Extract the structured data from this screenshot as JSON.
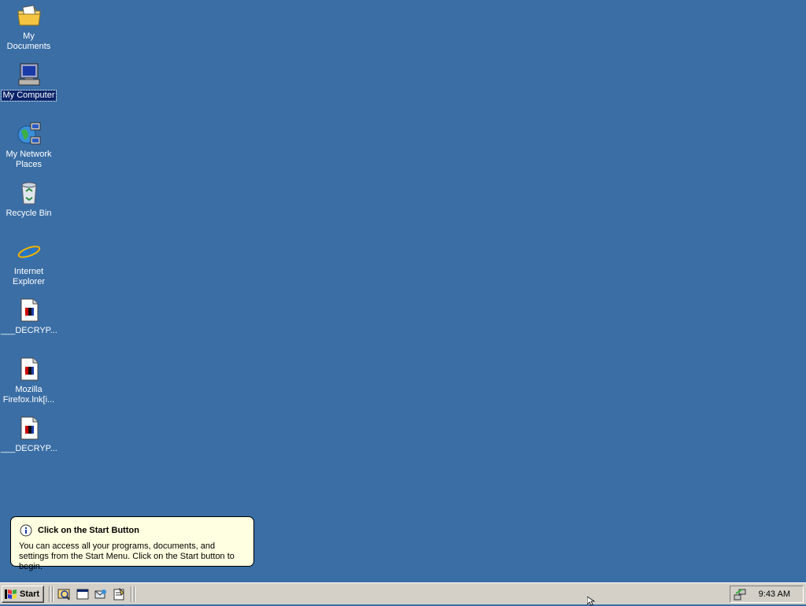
{
  "desktop": {
    "icons": [
      {
        "label": "My Documents",
        "icon": "folder-documents-icon"
      },
      {
        "label": "My Computer",
        "icon": "computer-icon",
        "selected": true
      },
      {
        "label": "My Network Places",
        "icon": "network-icon"
      },
      {
        "label": "Recycle Bin",
        "icon": "recycle-bin-icon"
      },
      {
        "label": "Internet Explorer",
        "icon": "ie-icon"
      },
      {
        "label": "___DECRYP...",
        "icon": "file-shortcut-icon"
      },
      {
        "label": "Mozilla Firefox.lnk[i...",
        "icon": "file-shortcut-icon"
      },
      {
        "label": "___DECRYP...",
        "icon": "file-shortcut-icon"
      }
    ],
    "background_color": "#3a6ea5"
  },
  "balloon": {
    "title": "Click on the Start Button",
    "body": "You can access all your programs, documents, and settings from the Start Menu. Click on the Start button to begin.",
    "icon": "info-icon"
  },
  "taskbar": {
    "start_label": "Start",
    "quick_launch": [
      "show-desktop-icon",
      "explorer-icon",
      "outlook-express-icon",
      "notepad-icon"
    ],
    "clock": "9:43 AM",
    "tray_icon": "network-tray-icon"
  }
}
